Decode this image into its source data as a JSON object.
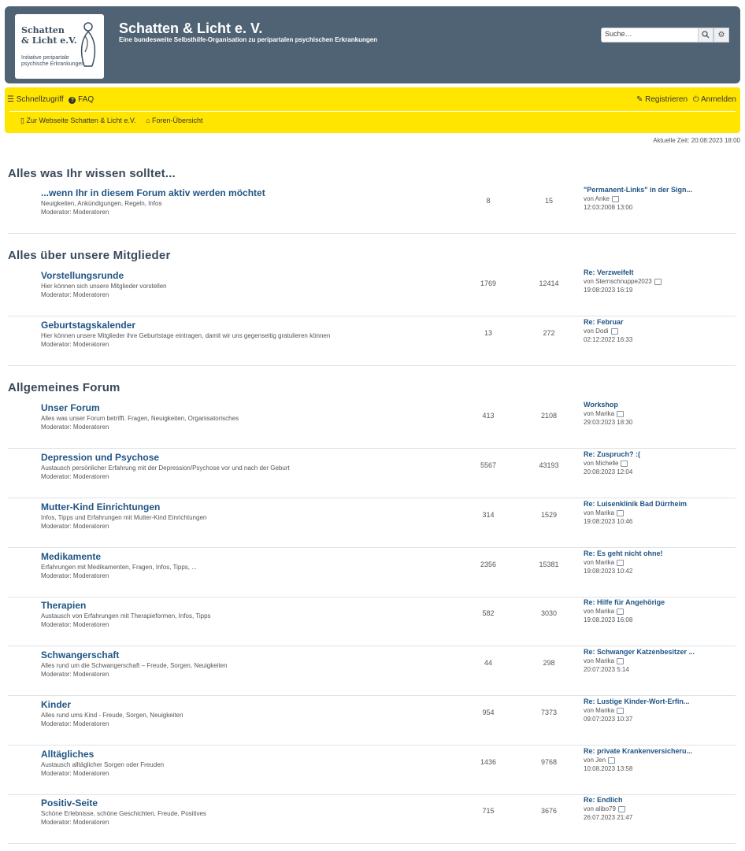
{
  "header": {
    "logo_name": "Schatten\n& Licht e.V.",
    "logo_sub": "Initiative peripartale\npsychische Erkrankungen",
    "title": "Schatten & Licht e. V.",
    "description": "Eine bundesweite Selbsthilfe-Organisation zu peripartalen psychischen Erkrankungen",
    "search_placeholder": "Suche…"
  },
  "nav": {
    "quick_access": "Schnellzugriff",
    "faq": "FAQ",
    "register": "Registrieren",
    "login": "Anmelden",
    "crumb_site": "Zur Webseite Schatten & Licht e.V.",
    "crumb_index": "Foren-Übersicht"
  },
  "current_time": "Aktuelle Zeit: 20:08:2023 18:00",
  "categories": [
    {
      "title": "Alles was Ihr wissen solltet...",
      "forums": [
        {
          "title": "...wenn Ihr in diesem Forum aktiv werden möchtet",
          "desc": "Neuigkeiten, Ankündigungen, Regeln, Infos",
          "mod": "Moderator: Moderatoren",
          "topics": "8",
          "posts": "15",
          "last_title": "\"Permanent-Links\" in der Sign...",
          "last_by": "von Anke",
          "last_time": "12:03:2008 13:00"
        }
      ]
    },
    {
      "title": "Alles über unsere Mitglieder",
      "forums": [
        {
          "title": "Vorstellungsrunde",
          "desc": "Hier können sich unsere Mitglieder vorstellen",
          "mod": "Moderator: Moderatoren",
          "topics": "1769",
          "posts": "12414",
          "last_title": "Re: Verzweifelt",
          "last_by": "von Sternschnuppe2023",
          "last_time": "19:08:2023 16:19"
        },
        {
          "title": "Geburtstagskalender",
          "desc": "Hier können unsere Mitglieder ihre Geburtstage eintragen, damit wir uns gegenseitig gratulieren können",
          "mod": "Moderator: Moderatoren",
          "topics": "13",
          "posts": "272",
          "last_title": "Re: Februar",
          "last_by": "von Dodi",
          "last_time": "02:12:2022 16:33"
        }
      ]
    },
    {
      "title": "Allgemeines Forum",
      "forums": [
        {
          "title": "Unser Forum",
          "desc": "Alles was unser Forum betrifft. Fragen, Neuigkeiten, Organisatorisches",
          "mod": "Moderator: Moderatoren",
          "topics": "413",
          "posts": "2108",
          "last_title": "Workshop",
          "last_by": "von Marika",
          "last_time": "29:03:2023 18:30"
        },
        {
          "title": "Depression und Psychose",
          "desc": "Austausch persönlicher Erfahrung mit der Depression/Psychose vor und nach der Geburt",
          "mod": "Moderator: Moderatoren",
          "topics": "5567",
          "posts": "43193",
          "last_title": "Re: Zuspruch? :(",
          "last_by": "von Michelle",
          "last_time": "20:08:2023 12:04"
        },
        {
          "title": "Mutter-Kind Einrichtungen",
          "desc": "Infos, Tipps und Erfahrungen mit Mutter-Kind Einrichtungen",
          "mod": "Moderator: Moderatoren",
          "topics": "314",
          "posts": "1529",
          "last_title": "Re: Luisenklinik Bad Dürrheim",
          "last_by": "von Marika",
          "last_time": "19:08:2023 10:46"
        },
        {
          "title": "Medikamente",
          "desc": "Erfahrungen mit Medikamenten, Fragen, Infos, Tipps, ...",
          "mod": "Moderator: Moderatoren",
          "topics": "2356",
          "posts": "15381",
          "last_title": "Re: Es geht nicht ohne!",
          "last_by": "von Marika",
          "last_time": "19:08:2023 10:42"
        },
        {
          "title": "Therapien",
          "desc": "Austausch von Erfahrungen mit Therapieformen, Infos, Tipps",
          "mod": "Moderator: Moderatoren",
          "topics": "582",
          "posts": "3030",
          "last_title": "Re: Hilfe für Angehörige",
          "last_by": "von Marika",
          "last_time": "19:08.2023 16:08"
        },
        {
          "title": "Schwangerschaft",
          "desc": "Alles rund um die Schwangerschaft – Freude, Sorgen, Neuigkeiten",
          "mod": "Moderator: Moderatoren",
          "topics": "44",
          "posts": "298",
          "last_title": "Re: Schwanger Katzenbesitzer ...",
          "last_by": "von Marika",
          "last_time": "20:07:2023 5:14"
        },
        {
          "title": "Kinder",
          "desc": "Alles rund ums Kind - Freude, Sorgen, Neuigkeiten",
          "mod": "Moderator: Moderatoren",
          "topics": "954",
          "posts": "7373",
          "last_title": "Re: Lustige Kinder-Wort-Erfin...",
          "last_by": "von Marika",
          "last_time": "09:07:2023 10:37"
        },
        {
          "title": "Alltägliches",
          "desc": "Austausch alltäglicher Sorgen oder Freuden",
          "mod": "Moderator: Moderatoren",
          "topics": "1436",
          "posts": "9768",
          "last_title": "Re: private Krankenversicheru...",
          "last_by": "von Jen",
          "last_time": "10:08.2023 13:58"
        },
        {
          "title": "Positiv-Seite",
          "desc": "Schöne Erlebnisse, schöne Geschichten, Freude, Positives",
          "mod": "Moderator: Moderatoren",
          "topics": "715",
          "posts": "3676",
          "last_title": "Re: Endlich",
          "last_by": "von alibo79",
          "last_time": "26:07.2023 21:47"
        }
      ]
    }
  ]
}
